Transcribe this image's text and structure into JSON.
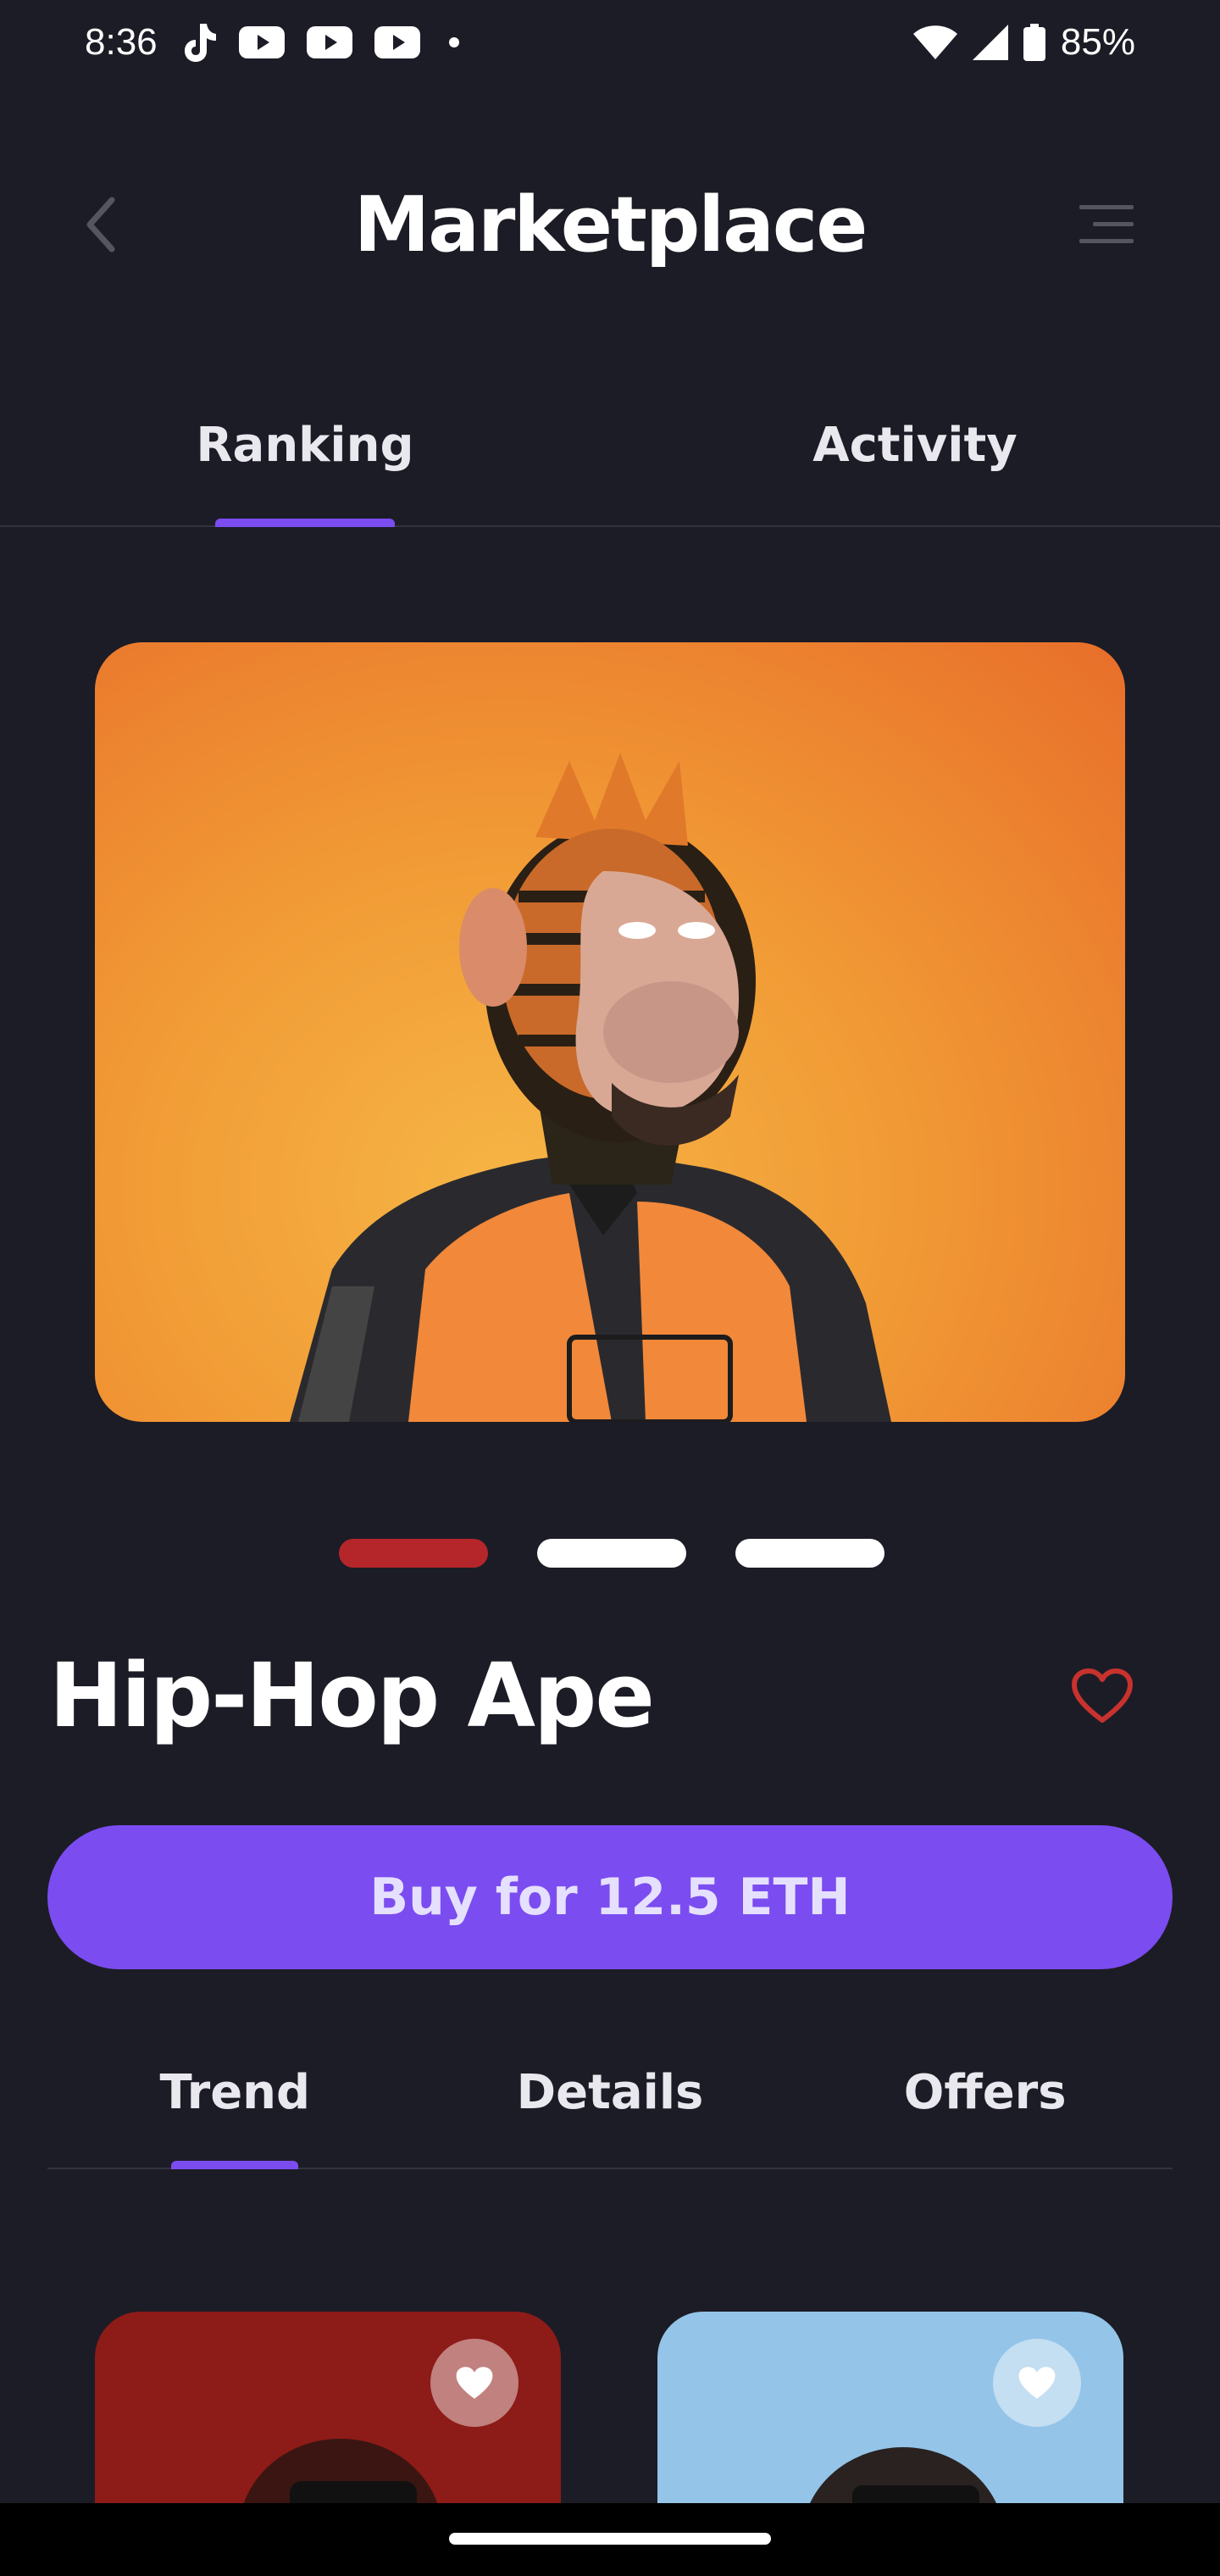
{
  "status_bar": {
    "time": "8:36",
    "battery": "85%",
    "icons": [
      "tiktok-icon",
      "youtube-icon",
      "youtube-icon",
      "youtube-icon",
      "dot-icon",
      "wifi-icon",
      "signal-icon",
      "battery-icon"
    ]
  },
  "header": {
    "title": "Marketplace",
    "back_icon": "chevron-left-icon",
    "menu_icon": "menu-icon"
  },
  "top_tabs": [
    {
      "label": "Ranking",
      "active": true
    },
    {
      "label": "Activity",
      "active": false
    }
  ],
  "hero": {
    "carousel_count": 3,
    "active_index": 0
  },
  "item": {
    "title": "Hip-Hop Ape",
    "buy_label": "Buy for 12.5 ETH"
  },
  "sub_tabs": [
    {
      "label": "Trend",
      "active": true
    },
    {
      "label": "Details",
      "active": false
    },
    {
      "label": "Offers",
      "active": false
    }
  ],
  "colors": {
    "background": "#1c1c26",
    "accent": "#7b4cf0",
    "active_dot": "#b5262a",
    "favorite": "#c8322e"
  }
}
